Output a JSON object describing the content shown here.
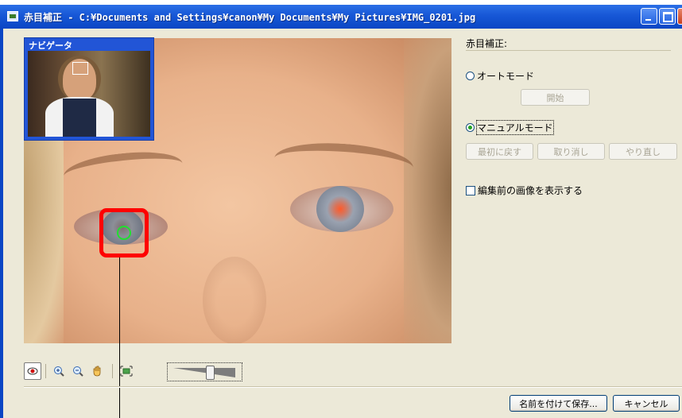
{
  "window": {
    "title": "赤目補正 - C:¥Documents and Settings¥canon¥My Documents¥My Pictures¥IMG_0201.jpg",
    "icon": "app-image-icon",
    "controls": [
      "minimize-icon",
      "maximize-icon",
      "close-icon"
    ]
  },
  "navigator": {
    "title": "ナビゲータ"
  },
  "panel": {
    "heading": "赤目補正:",
    "auto_mode_label": "オートモード",
    "auto_mode_selected": false,
    "start_button": "開始",
    "manual_mode_label": "マニュアルモード",
    "manual_mode_selected": true,
    "reset_button": "最初に戻す",
    "undo_button": "取り消し",
    "redo_button": "やり直し",
    "show_original_label": "編集前の画像を表示する",
    "show_original_checked": false
  },
  "toolbar": {
    "tools": [
      {
        "icon": "red-eye-tool-icon",
        "pressed": true
      },
      {
        "icon": "zoom-in-icon"
      },
      {
        "icon": "zoom-out-icon"
      },
      {
        "icon": "hand-pan-icon"
      },
      {
        "icon": "fit-to-window-icon"
      }
    ],
    "brush_size_level": 0.6
  },
  "footer": {
    "save_as_button": "名前を付けて保存...",
    "cancel_button": "キャンセル"
  },
  "colors": {
    "titlebar": "#0a46c4",
    "selection_box": "#ff0000",
    "target_ring": "#20e030",
    "dialog_bg": "#ece9d8"
  }
}
